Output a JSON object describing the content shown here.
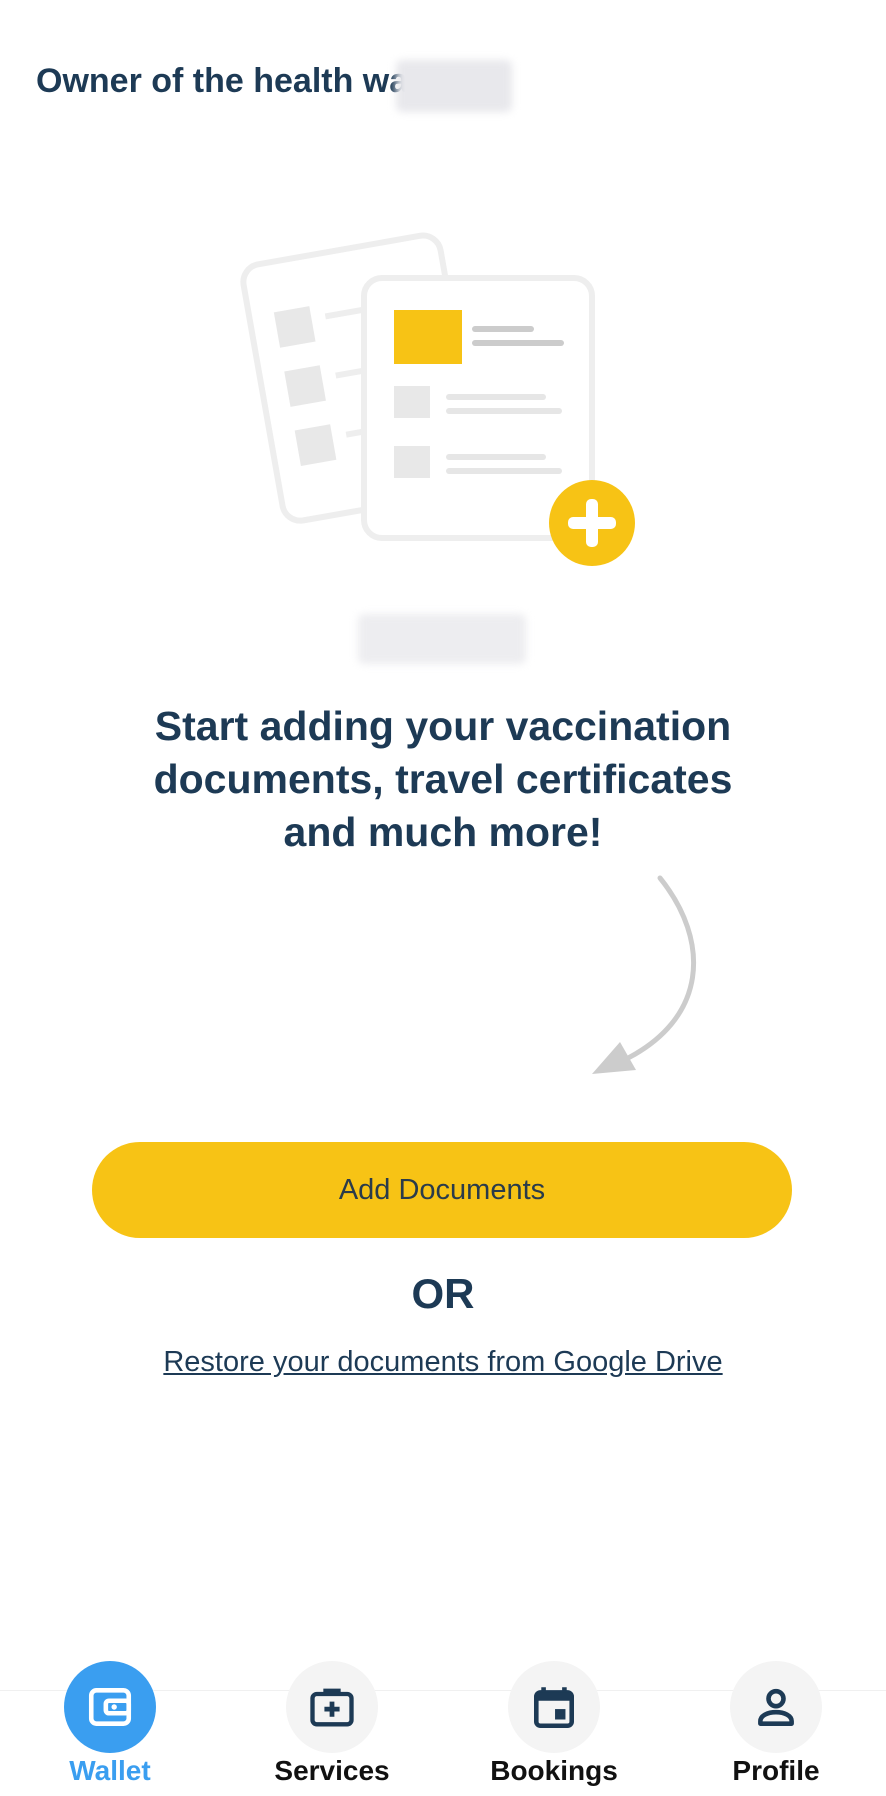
{
  "header": {
    "title": "Owner of the health wa"
  },
  "main": {
    "headline_line1": "Start adding your vaccination",
    "headline_line2": "documents, travel certificates",
    "headline_line3": "and much more!",
    "add_button_label": "Add Documents",
    "or_label": "OR",
    "restore_link_label": "Restore your documents from Google Drive"
  },
  "nav": {
    "items": [
      {
        "label": "Wallet",
        "icon": "wallet-icon",
        "active": true
      },
      {
        "label": "Services",
        "icon": "medical-bag-icon",
        "active": false
      },
      {
        "label": "Bookings",
        "icon": "calendar-icon",
        "active": false
      },
      {
        "label": "Profile",
        "icon": "person-icon",
        "active": false
      }
    ]
  },
  "colors": {
    "accent_yellow": "#f7c315",
    "active_blue": "#3a9ef0",
    "text_navy": "#1d3a55"
  }
}
